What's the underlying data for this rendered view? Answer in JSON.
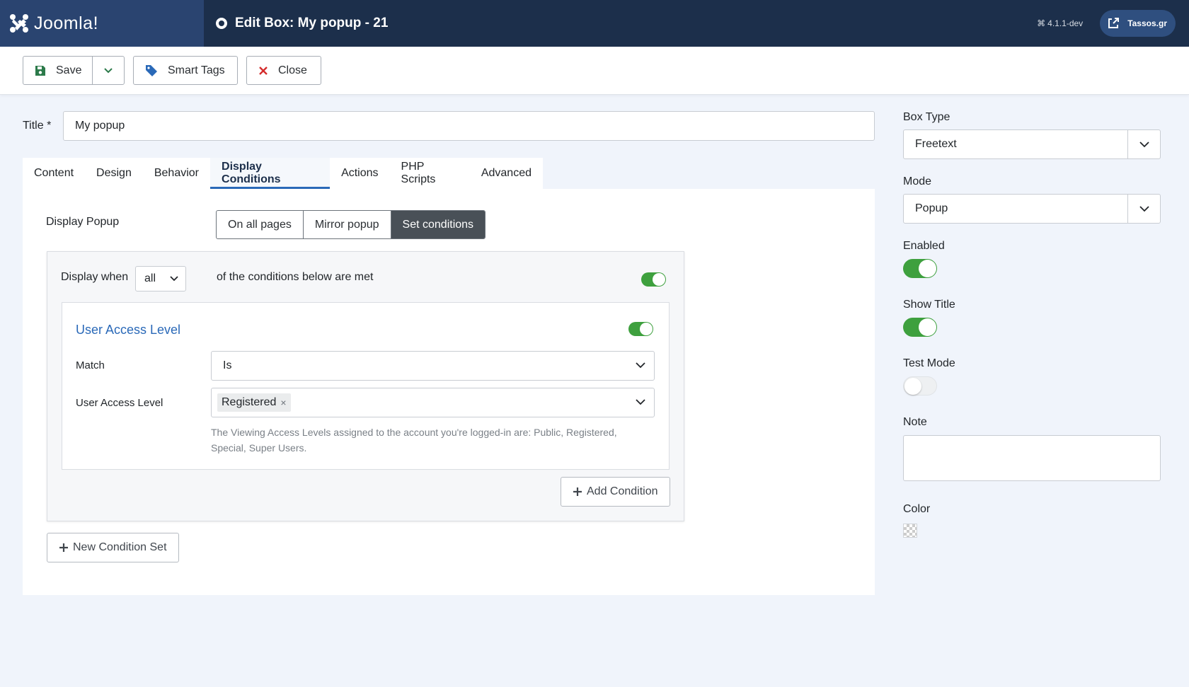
{
  "header": {
    "brand_name": "Joomla!",
    "page_title": "Edit Box: My popup - 21",
    "version": "4.1.1-dev",
    "site_name": "Tassos.gr"
  },
  "toolbar": {
    "save_label": "Save",
    "smart_tags_label": "Smart Tags",
    "close_label": "Close"
  },
  "form": {
    "title_label": "Title *",
    "title_value": "My popup"
  },
  "tabs": [
    {
      "label": "Content",
      "active": false
    },
    {
      "label": "Design",
      "active": false
    },
    {
      "label": "Behavior",
      "active": false
    },
    {
      "label": "Display Conditions",
      "active": true
    },
    {
      "label": "Actions",
      "active": false
    },
    {
      "label": "PHP Scripts",
      "active": false
    },
    {
      "label": "Advanced",
      "active": false
    }
  ],
  "display": {
    "label": "Display Popup",
    "options": [
      "On all pages",
      "Mirror popup",
      "Set conditions"
    ],
    "selected": "Set conditions"
  },
  "condition_set": {
    "display_when_label": "Display when",
    "match_value": "all",
    "tail_text": "of the conditions below are met",
    "enabled": true,
    "condition": {
      "title": "User Access Level",
      "enabled": true,
      "match_label": "Match",
      "match_value": "Is",
      "level_label": "User Access Level",
      "level_tags": [
        "Registered"
      ],
      "tag_remove": "×",
      "help": "The Viewing Access Levels assigned to the account you're logged-in are: Public, Registered, Special, Super Users."
    },
    "add_condition_label": "Add Condition"
  },
  "new_condition_set_label": "New Condition Set",
  "sidebar": {
    "box_type_label": "Box Type",
    "box_type_value": "Freetext",
    "mode_label": "Mode",
    "mode_value": "Popup",
    "enabled_label": "Enabled",
    "enabled": true,
    "show_title_label": "Show Title",
    "show_title": true,
    "test_mode_label": "Test Mode",
    "test_mode": false,
    "note_label": "Note",
    "note_value": "",
    "color_label": "Color"
  },
  "colors": {
    "header_bg": "#1c2f4b",
    "accent": "#2a69b8",
    "toggle_on": "#3ea03e",
    "close_icon": "#d42c2c"
  }
}
